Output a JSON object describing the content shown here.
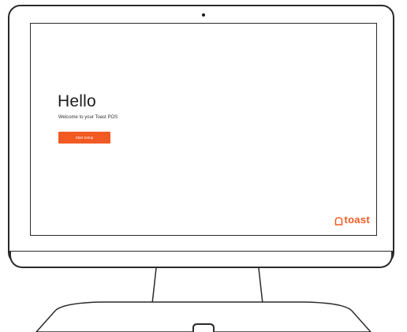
{
  "screen": {
    "heading": "Hello",
    "subtitle": "Welcome to your Toast POS",
    "start_button_label": "Start Setup"
  },
  "brand": {
    "logo_text": "toast",
    "accent_color": "#f15a22",
    "logo_icon": "toast-bread-icon"
  }
}
